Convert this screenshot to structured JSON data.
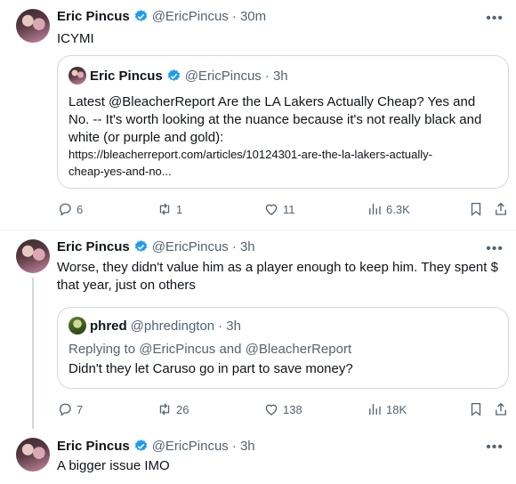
{
  "tweets": [
    {
      "name": "Eric Pincus",
      "handle": "@EricPincus",
      "time": "· 30m",
      "text": "ICYMI",
      "quote": {
        "name": "Eric Pincus",
        "handle": "@EricPincus",
        "time": "· 3h",
        "text": "Latest @BleacherReport Are the LA Lakers Actually Cheap? Yes and No. -- It's worth looking at the nuance because it's not really black and white (or purple and gold):",
        "link_line1": "https://bleacherreport.com/articles/10124301-are-the-la-lakers-actually-",
        "link_line2": "cheap-yes-and-no..."
      },
      "actions": {
        "replies": "6",
        "retweets": "1",
        "likes": "11",
        "views": "6.3K"
      }
    },
    {
      "name": "Eric Pincus",
      "handle": "@EricPincus",
      "time": "· 3h",
      "text_line1": "Worse, they didn't value him as a player enough to keep him. They spent $",
      "text_line2": "that year, just on others",
      "quote": {
        "name": "phred",
        "handle": "@phredington",
        "time": "· 3h",
        "replying": "Replying to @EricPincus and @BleacherReport",
        "text": "Didn't they let Caruso go in part to save money?"
      },
      "actions": {
        "replies": "7",
        "retweets": "26",
        "likes": "138",
        "views": "18K"
      }
    },
    {
      "name": "Eric Pincus",
      "handle": "@EricPincus",
      "time": "· 3h",
      "text": "A bigger issue IMO"
    }
  ],
  "colors": {
    "text": "#0f1419",
    "secondary": "#536471",
    "verified": "#1d9bf0",
    "border": "#cfd9de"
  },
  "icons": [
    "more-icon",
    "verified-icon",
    "reply-icon",
    "retweet-icon",
    "like-icon",
    "views-icon",
    "bookmark-icon",
    "share-icon"
  ]
}
